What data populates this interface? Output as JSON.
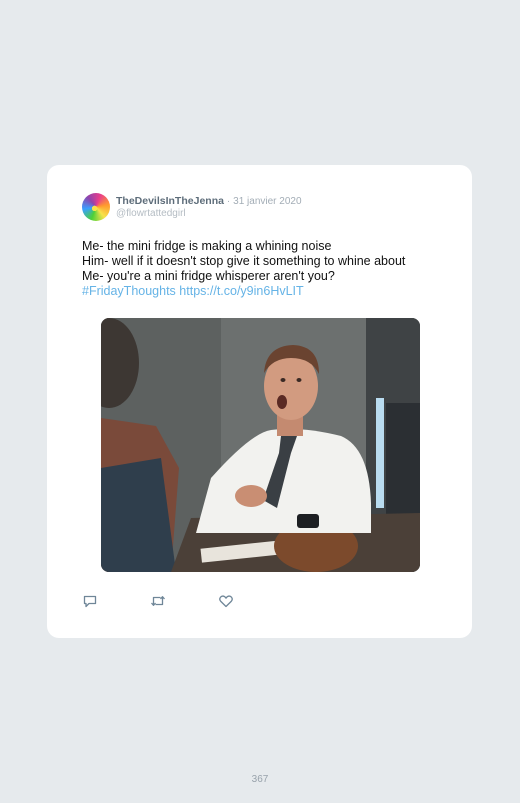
{
  "tweet": {
    "display_name": "TheDevilsInTheJenna",
    "separator": "·",
    "date": "31 janvier 2020",
    "handle": "@flowrtattedgirl",
    "text_lines": [
      "Me- the mini fridge is making a whining noise",
      "Him- well if it doesn't stop give it something to whine about",
      "Me- you're a mini fridge whisperer aren't you?"
    ],
    "hashtag": "#FridayThoughts",
    "link": "https://t.co/y9in6HvLIT",
    "media_alt": "",
    "actions": {
      "reply_icon": "reply-icon",
      "retweet_icon": "retweet-icon",
      "like_icon": "heart-icon"
    }
  },
  "page": {
    "number": "367"
  },
  "colors": {
    "background": "#e6eaed",
    "card": "#ffffff",
    "link": "#65b3e6",
    "icon": "#6f8698"
  }
}
